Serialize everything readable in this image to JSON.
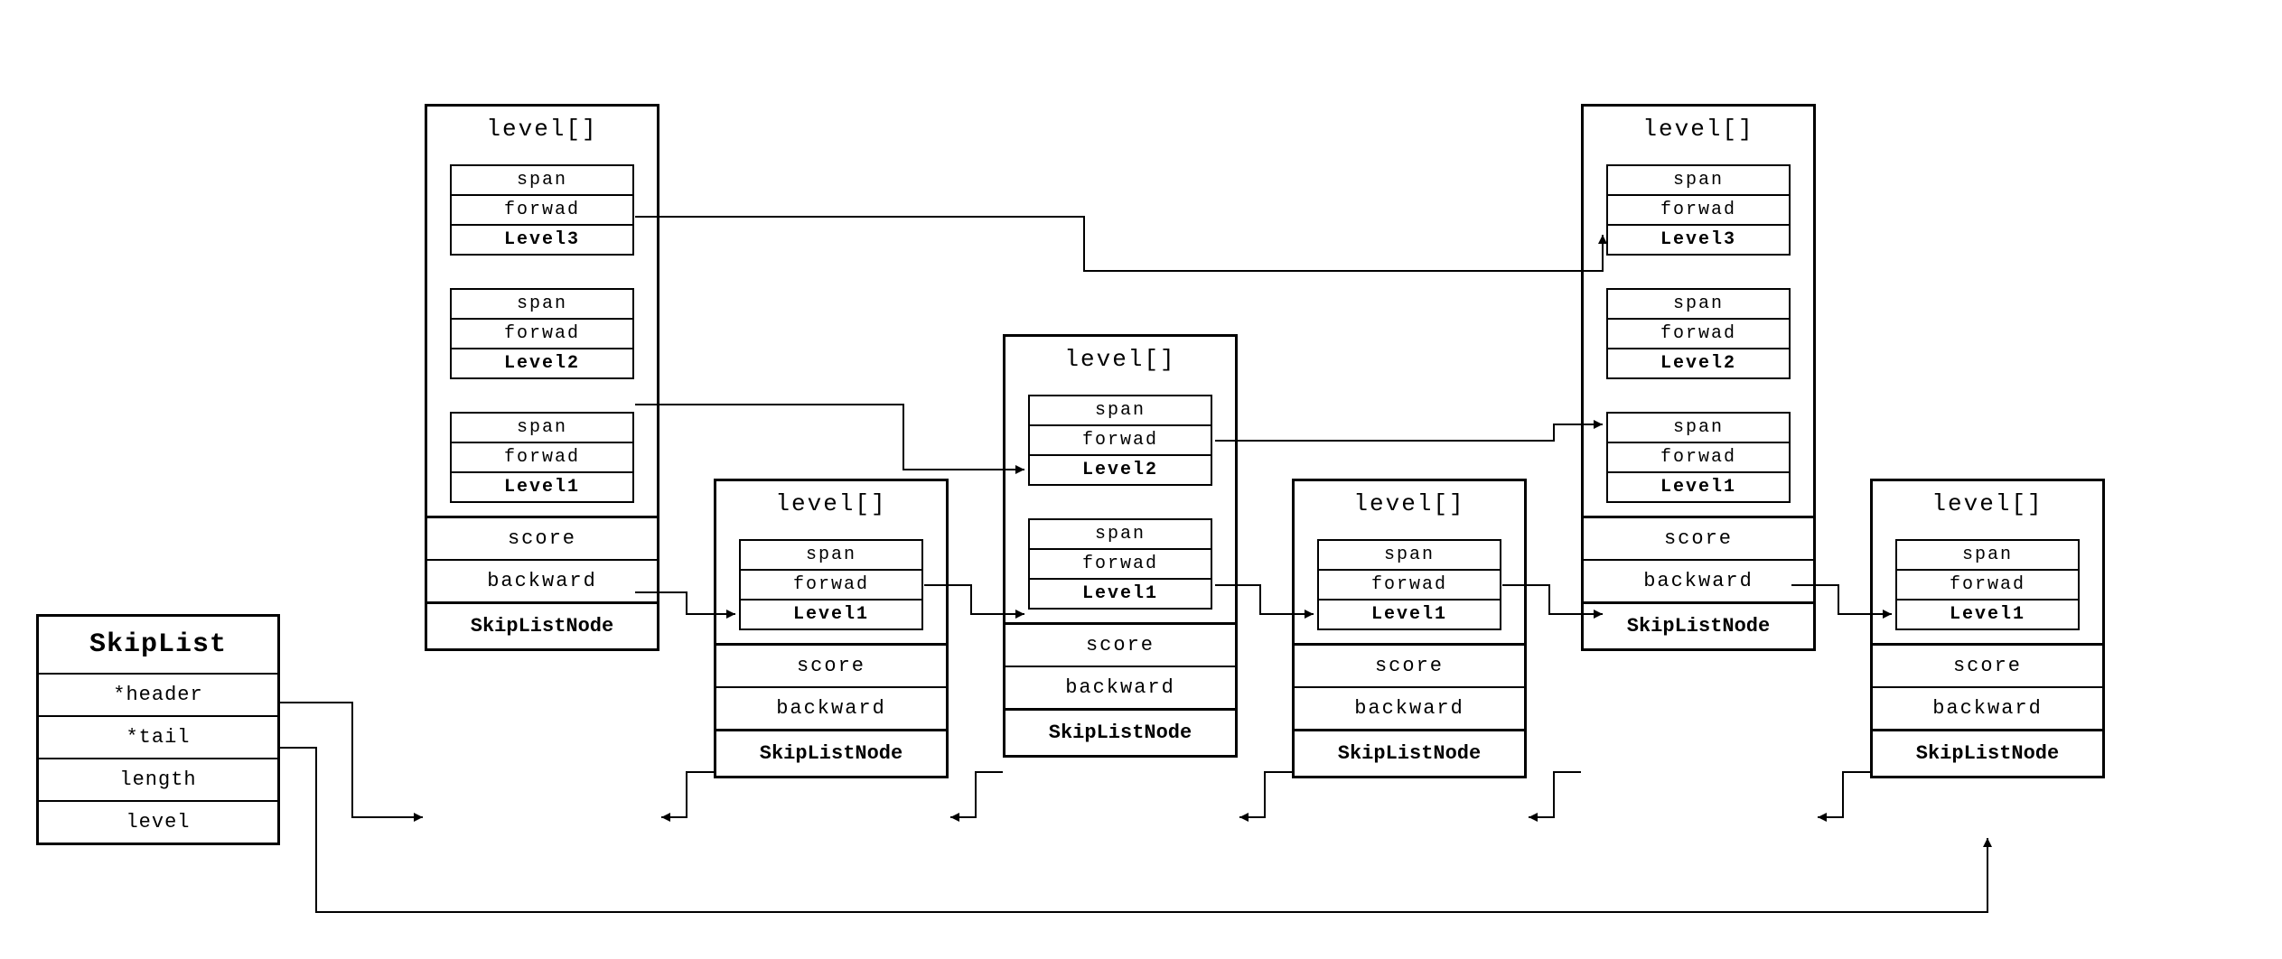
{
  "skiplist": {
    "title": "SkipList",
    "fields": [
      "*header",
      "*tail",
      "length",
      "level"
    ]
  },
  "labels": {
    "level_array": "level[]",
    "span": "span",
    "forward": "forwad",
    "score": "score",
    "backward": "backward",
    "node_name": "SkipListNode",
    "level1": "Level1",
    "level2": "Level2",
    "level3": "Level3"
  },
  "nodes": [
    {
      "id": "n1",
      "levels": 3
    },
    {
      "id": "n2",
      "levels": 1
    },
    {
      "id": "n3",
      "levels": 2
    },
    {
      "id": "n4",
      "levels": 1
    },
    {
      "id": "n5",
      "levels": 3
    },
    {
      "id": "n6",
      "levels": 1
    }
  ],
  "forward_links": [
    {
      "from": "n1",
      "level": 3,
      "to": "n5"
    },
    {
      "from": "n1",
      "level": 2,
      "to": "n3"
    },
    {
      "from": "n3",
      "level": 2,
      "to": "n5"
    },
    {
      "from": "n1",
      "level": 1,
      "to": "n2"
    },
    {
      "from": "n2",
      "level": 1,
      "to": "n3"
    },
    {
      "from": "n3",
      "level": 1,
      "to": "n4"
    },
    {
      "from": "n4",
      "level": 1,
      "to": "n5"
    },
    {
      "from": "n5",
      "level": 1,
      "to": "n6"
    }
  ],
  "backward_links": [
    {
      "from": "n2",
      "to": "n1"
    },
    {
      "from": "n3",
      "to": "n2"
    },
    {
      "from": "n4",
      "to": "n3"
    },
    {
      "from": "n5",
      "to": "n4"
    },
    {
      "from": "n6",
      "to": "n5"
    }
  ],
  "header_link": {
    "from": "skiplist.header",
    "to": "n1"
  },
  "tail_link": {
    "from": "skiplist.tail",
    "to": "n6"
  }
}
